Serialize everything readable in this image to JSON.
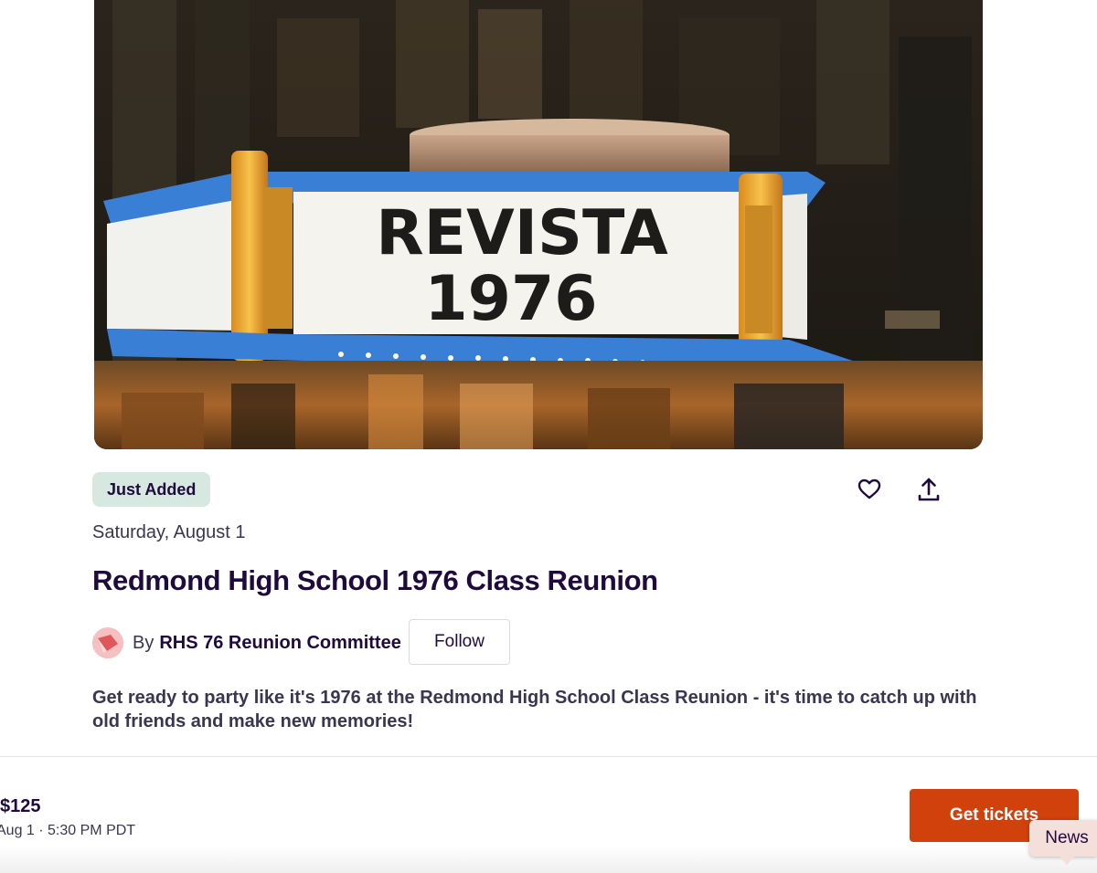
{
  "hero": {
    "marquee_line1": "REVISTA",
    "marquee_line2": "1976"
  },
  "badge": "Just Added",
  "icons": {
    "like": "heart-icon",
    "share": "share-upload-icon"
  },
  "event": {
    "date": "Saturday, August 1",
    "title": "Redmond High School 1976 Class Reunion",
    "summary": "Get ready to party like it's 1976 at the Redmond High School Class Reunion - it's time to catch up with old friends and make new memories!"
  },
  "organizer": {
    "by_label": "By",
    "name": "RHS 76 Reunion Committee",
    "follow_label": "Follow"
  },
  "bottom_bar": {
    "price": "$125",
    "datetime": "Aug 1 · 5:30 PM PDT",
    "cta_label": "Get tickets"
  },
  "news_tab": "News",
  "colors": {
    "brand_orange": "#d1410c",
    "badge_bg": "#d6e8e0",
    "title_color": "#1e0a3c"
  }
}
